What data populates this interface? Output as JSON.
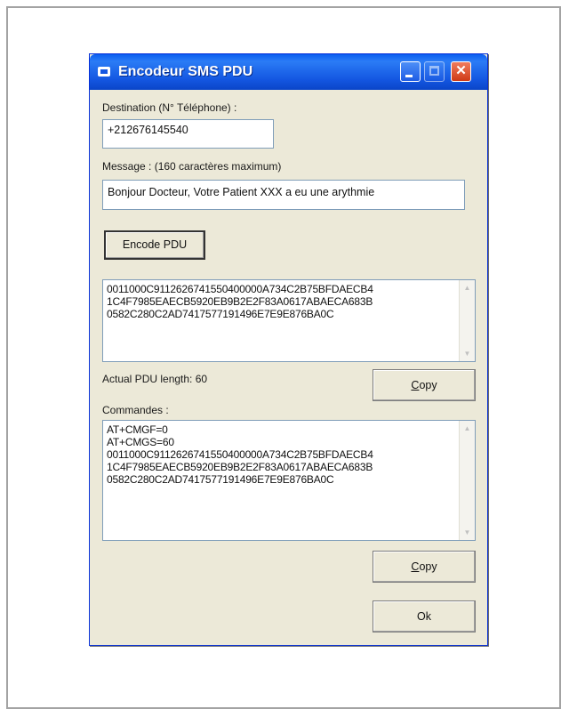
{
  "window": {
    "title": "Encodeur SMS PDU",
    "controls": {
      "minimize": "minimize",
      "maximize": "maximize",
      "close": "✕"
    }
  },
  "destination": {
    "label": "Destination  (N° Téléphone) :",
    "value": "+212676145540"
  },
  "message": {
    "label": "Message : (160 caractères maximum)",
    "value": "Bonjour Docteur, Votre Patient XXX a eu une arythmie"
  },
  "encode_button": "Encode PDU",
  "pdu_output": "0011000C9112626741550400000A734C2B75BFDAECB4\n1C4F7985EAECB5920EB9B2E2F83A0617ABAECA683B\n0582C280C2AD7417577191496E7E9E876BA0C",
  "pdu_length_label": "Actual PDU length: 60",
  "copy_button_1": {
    "prefix": "",
    "accel": "C",
    "rest": "opy"
  },
  "commands": {
    "label": "Commandes :",
    "value": "AT+CMGF=0\nAT+CMGS=60\n0011000C9112626741550400000A734C2B75BFDAECB4\n1C4F7985EAECB5920EB9B2E2F83A0617ABAECA683B\n0582C280C2AD7417577191496E7E9E876BA0C"
  },
  "copy_button_2": {
    "prefix": "",
    "accel": "C",
    "rest": "opy"
  },
  "ok_button": "Ok"
}
